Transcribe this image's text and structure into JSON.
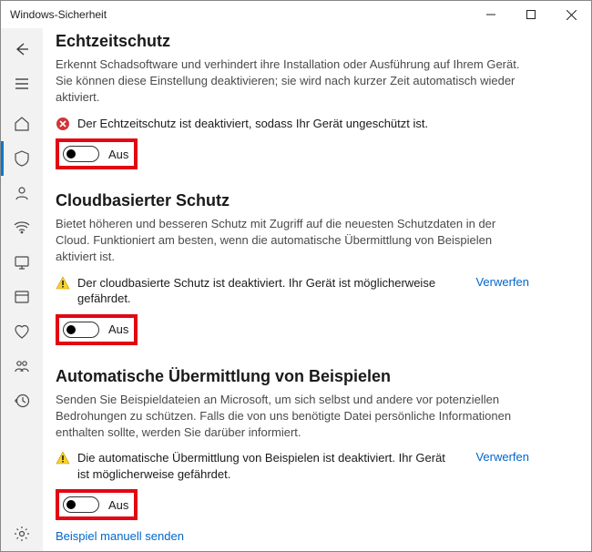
{
  "window": {
    "title": "Windows-Sicherheit"
  },
  "sidebar": {
    "items": [
      {
        "name": "home-icon"
      },
      {
        "name": "shield-icon"
      },
      {
        "name": "person-icon"
      },
      {
        "name": "wifi-icon"
      },
      {
        "name": "network-icon"
      },
      {
        "name": "app-browser-icon"
      },
      {
        "name": "device-health-icon"
      },
      {
        "name": "family-icon"
      },
      {
        "name": "history-icon"
      }
    ],
    "footer": {
      "name": "settings-icon"
    }
  },
  "sections": {
    "realtime": {
      "title": "Echtzeitschutz",
      "desc": "Erkennt Schadsoftware und verhindert ihre Installation oder Ausführung auf Ihrem Gerät. Sie können diese Einstellung deaktivieren; sie wird nach kurzer Zeit automatisch wieder aktiviert.",
      "alert_text": "Der Echtzeitschutz ist deaktiviert, sodass Ihr Gerät ungeschützt ist.",
      "toggle_label": "Aus"
    },
    "cloud": {
      "title": "Cloudbasierter Schutz",
      "desc": "Bietet höheren und besseren Schutz mit Zugriff auf die neuesten Schutzdaten in der Cloud. Funktioniert am besten, wenn die automatische Übermittlung von Beispielen aktiviert ist.",
      "alert_text": "Der cloudbasierte Schutz ist deaktiviert. Ihr Gerät ist möglicherweise gefährdet.",
      "dismiss_label": "Verwerfen",
      "toggle_label": "Aus"
    },
    "samples": {
      "title": "Automatische Übermittlung von Beispielen",
      "desc": "Senden Sie Beispieldateien an Microsoft, um sich selbst und andere vor potenziellen Bedrohungen zu schützen. Falls die von uns benötigte Datei persönliche Informationen enthalten sollte, werden Sie darüber informiert.",
      "alert_text": "Die automatische Übermittlung von Beispielen ist deaktiviert. Ihr Gerät ist möglicherweise gefährdet.",
      "dismiss_label": "Verwerfen",
      "toggle_label": "Aus",
      "manual_link": "Beispiel manuell senden"
    }
  }
}
